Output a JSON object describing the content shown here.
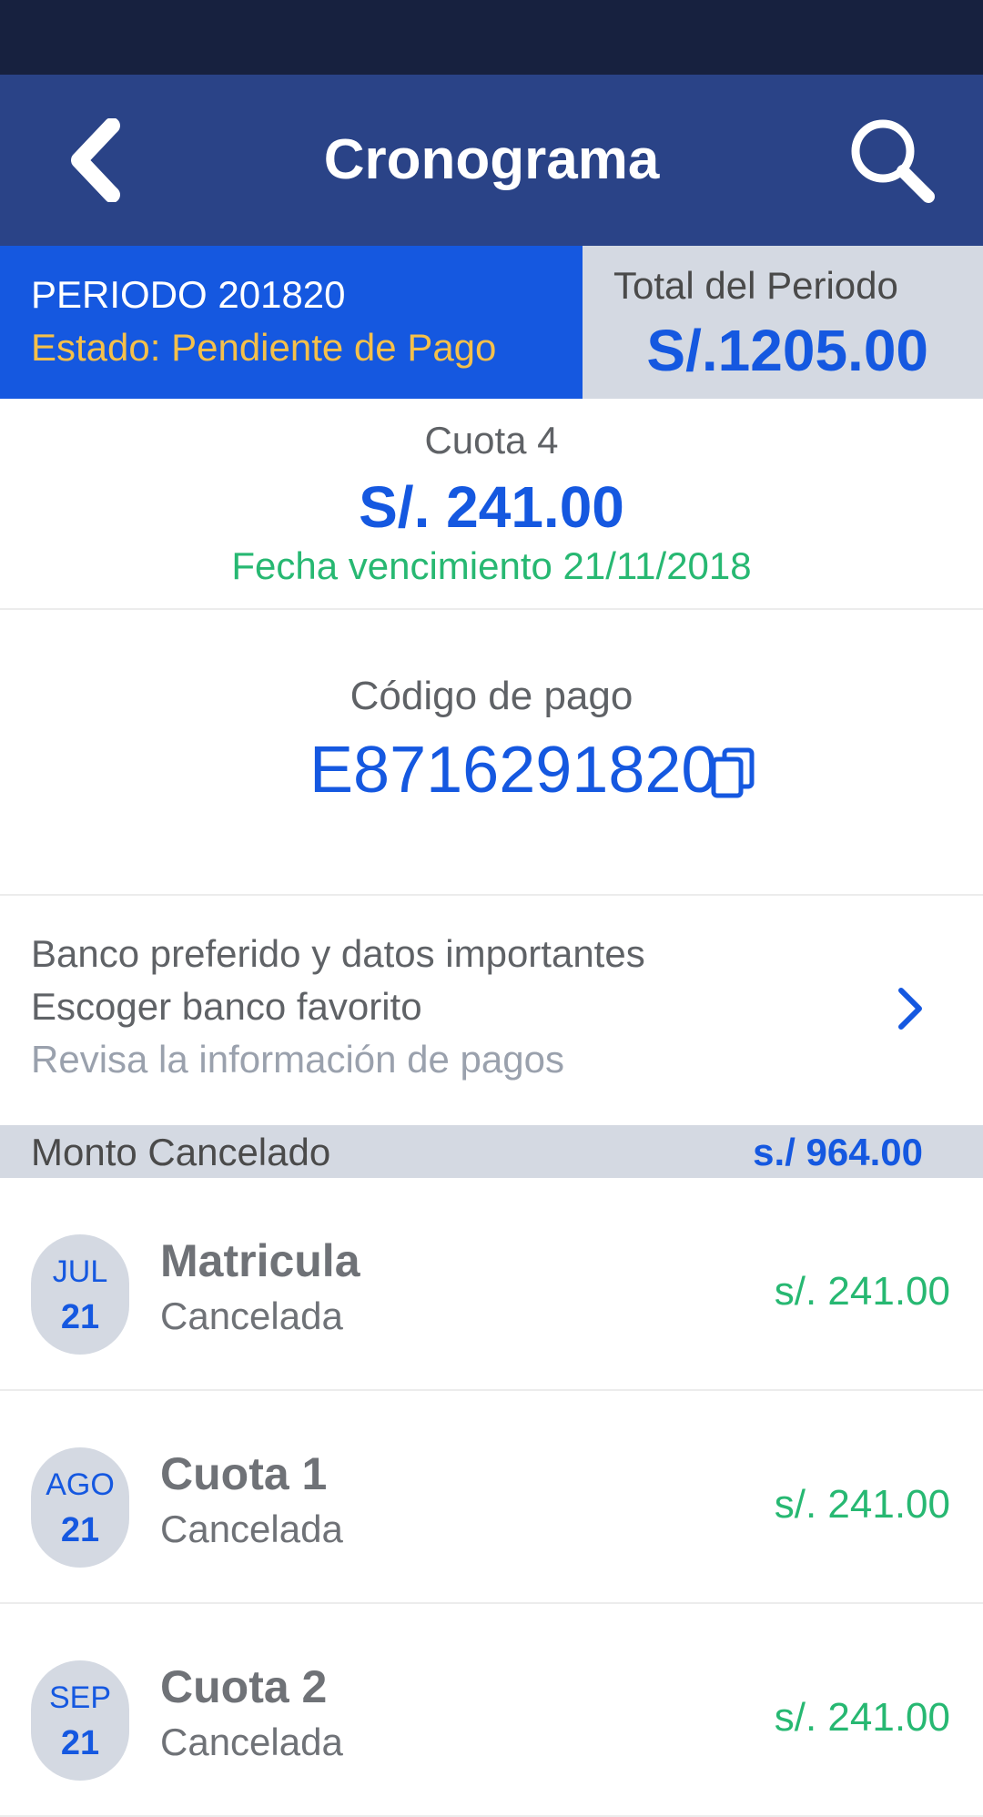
{
  "header": {
    "title": "Cronograma",
    "back_icon": "chevron-left-icon",
    "search_icon": "search-icon"
  },
  "period": {
    "title": "PERIODO 201820",
    "status": "Estado: Pendiente de Pago",
    "total_label": "Total del Periodo",
    "total_value": "S/.1205.00"
  },
  "cuota": {
    "label": "Cuota 4",
    "amount": "S/. 241.00",
    "due_date": "Fecha vencimiento 21/11/2018"
  },
  "payment_code": {
    "label": "Código de pago",
    "value": "E8716291820",
    "copy_icon": "copy-icon"
  },
  "bank": {
    "line1": "Banco preferido y datos importantes",
    "line2": "Escoger banco favorito",
    "line3": "Revisa la información de pagos"
  },
  "monto_cancelado": {
    "label": "Monto Cancelado",
    "value": "s./ 964.00"
  },
  "items": [
    {
      "month": "JUL",
      "day": "21",
      "title": "Matricula",
      "status": "Cancelada",
      "amount": "s/. 241.00"
    },
    {
      "month": "AGO",
      "day": "21",
      "title": "Cuota 1",
      "status": "Cancelada",
      "amount": "s/. 241.00"
    },
    {
      "month": "SEP",
      "day": "21",
      "title": "Cuota 2",
      "status": "Cancelada",
      "amount": "s/. 241.00"
    }
  ],
  "colors": {
    "status_bar": "#17213f",
    "nav_bar": "#2a4387",
    "accent_blue": "#1558e0",
    "pending_yellow": "#f5c04a",
    "paid_green": "#27b872",
    "gray_panel": "#d4d9e2"
  }
}
